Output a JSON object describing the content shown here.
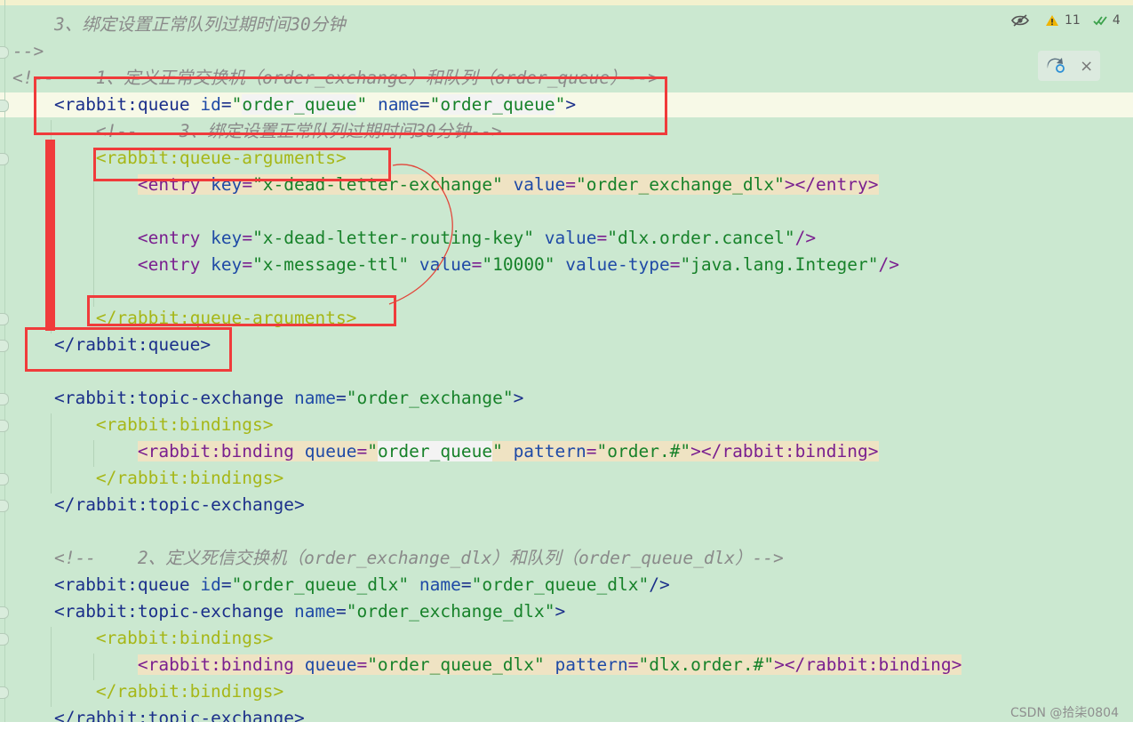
{
  "lines": [
    {
      "parts": [
        {
          "s": "c",
          "t": "    "
        }
      ]
    },
    {
      "parts": [
        {
          "s": "c",
          "t": "    3、绑定设置正常队列过期时间30分钟"
        }
      ]
    },
    {
      "parts": [
        {
          "s": "c",
          "t": "-->"
        }
      ]
    },
    {
      "parts": [
        {
          "s": "c",
          "t": "<!--    1、定义正常交换机（order_exchange）和队列（order_queue）-->"
        }
      ]
    },
    {
      "parts": [
        {
          "s": "p",
          "t": "    "
        },
        {
          "s": "t",
          "t": "<rabbit:queue "
        },
        {
          "s": "an",
          "t": "id"
        },
        {
          "s": "t",
          "t": "="
        },
        {
          "s": "v",
          "t": "\""
        },
        {
          "s": "v hb",
          "t": "order_queue"
        },
        {
          "s": "v",
          "t": "\" "
        },
        {
          "s": "an",
          "t": "name"
        },
        {
          "s": "t",
          "t": "="
        },
        {
          "s": "v",
          "t": "\""
        },
        {
          "s": "v hb",
          "t": "order_queue"
        },
        {
          "s": "v",
          "t": "\""
        },
        {
          "s": "t",
          "t": ">"
        }
      ]
    },
    {
      "parts": [
        {
          "s": "c",
          "t": "        <!--    3、绑定设置正常队列过期时间30分钟-->"
        }
      ]
    },
    {
      "parts": [
        {
          "s": "p",
          "t": "        "
        },
        {
          "s": "y",
          "t": "<rabbit:queue-arguments>"
        }
      ]
    },
    {
      "parts": [
        {
          "s": "p",
          "t": "            "
        },
        {
          "s": "tp hl",
          "t": "<entry "
        },
        {
          "s": "an hl",
          "t": "key"
        },
        {
          "s": "tp hl",
          "t": "="
        },
        {
          "s": "v hl",
          "t": "\"x-dead-letter-exchange\" "
        },
        {
          "s": "an hl",
          "t": "value"
        },
        {
          "s": "tp hl",
          "t": "="
        },
        {
          "s": "v hl",
          "t": "\"order_exchange_dlx\""
        },
        {
          "s": "tp hl",
          "t": "></entry>"
        }
      ]
    },
    {
      "parts": [
        {
          "s": "p",
          "t": " "
        }
      ]
    },
    {
      "parts": [
        {
          "s": "p",
          "t": "            "
        },
        {
          "s": "tp",
          "t": "<entry "
        },
        {
          "s": "an",
          "t": "key"
        },
        {
          "s": "tp",
          "t": "="
        },
        {
          "s": "v",
          "t": "\"x-dead-letter-routing-key\" "
        },
        {
          "s": "an",
          "t": "value"
        },
        {
          "s": "tp",
          "t": "="
        },
        {
          "s": "v",
          "t": "\"dlx.order.cancel\""
        },
        {
          "s": "tp",
          "t": "/>"
        }
      ]
    },
    {
      "parts": [
        {
          "s": "p",
          "t": "            "
        },
        {
          "s": "tp",
          "t": "<entry "
        },
        {
          "s": "an",
          "t": "key"
        },
        {
          "s": "tp",
          "t": "="
        },
        {
          "s": "v",
          "t": "\"x-message-ttl\" "
        },
        {
          "s": "an",
          "t": "value"
        },
        {
          "s": "tp",
          "t": "="
        },
        {
          "s": "v",
          "t": "\"10000\" "
        },
        {
          "s": "an",
          "t": "value-type"
        },
        {
          "s": "tp",
          "t": "="
        },
        {
          "s": "v",
          "t": "\"java.lang.Integer\""
        },
        {
          "s": "tp",
          "t": "/>"
        }
      ]
    },
    {
      "parts": [
        {
          "s": "p",
          "t": " "
        }
      ]
    },
    {
      "parts": [
        {
          "s": "p",
          "t": "        "
        },
        {
          "s": "y",
          "t": "</rabbit:queue-arguments>"
        }
      ]
    },
    {
      "parts": [
        {
          "s": "p",
          "t": "    "
        },
        {
          "s": "t",
          "t": "</rabbit:queue>"
        }
      ]
    },
    {
      "parts": [
        {
          "s": "p",
          "t": " "
        }
      ]
    },
    {
      "parts": [
        {
          "s": "p",
          "t": "    "
        },
        {
          "s": "t",
          "t": "<rabbit:topic-exchange "
        },
        {
          "s": "an",
          "t": "name"
        },
        {
          "s": "t",
          "t": "="
        },
        {
          "s": "v",
          "t": "\"order_exchange\""
        },
        {
          "s": "t",
          "t": ">"
        }
      ]
    },
    {
      "parts": [
        {
          "s": "p",
          "t": "        "
        },
        {
          "s": "y",
          "t": "<rabbit:bindings>"
        }
      ]
    },
    {
      "parts": [
        {
          "s": "p",
          "t": "            "
        },
        {
          "s": "tp hl",
          "t": "<rabbit:binding "
        },
        {
          "s": "an hl",
          "t": "queue"
        },
        {
          "s": "tp hl",
          "t": "="
        },
        {
          "s": "v hl",
          "t": "\""
        },
        {
          "s": "v hb",
          "t": "order_queue"
        },
        {
          "s": "v hl",
          "t": "\" "
        },
        {
          "s": "an hl",
          "t": "pattern"
        },
        {
          "s": "tp hl",
          "t": "="
        },
        {
          "s": "v hl",
          "t": "\"order.#\""
        },
        {
          "s": "tp hl",
          "t": "></rabbit:binding>"
        }
      ]
    },
    {
      "parts": [
        {
          "s": "p",
          "t": "        "
        },
        {
          "s": "y",
          "t": "</rabbit:bindings>"
        }
      ]
    },
    {
      "parts": [
        {
          "s": "p",
          "t": "    "
        },
        {
          "s": "t",
          "t": "</rabbit:topic-exchange>"
        }
      ]
    },
    {
      "parts": [
        {
          "s": "p",
          "t": " "
        }
      ]
    },
    {
      "parts": [
        {
          "s": "c",
          "t": "    <!--    2、定义死信交换机（order_exchange_dlx）和队列（order_queue_dlx）-->"
        }
      ]
    },
    {
      "parts": [
        {
          "s": "p",
          "t": "    "
        },
        {
          "s": "t",
          "t": "<rabbit:queue "
        },
        {
          "s": "an",
          "t": "id"
        },
        {
          "s": "t",
          "t": "="
        },
        {
          "s": "v",
          "t": "\"order_queue_dlx\" "
        },
        {
          "s": "an",
          "t": "name"
        },
        {
          "s": "t",
          "t": "="
        },
        {
          "s": "v",
          "t": "\"order_queue_dlx\""
        },
        {
          "s": "t",
          "t": "/>"
        }
      ]
    },
    {
      "parts": [
        {
          "s": "p",
          "t": "    "
        },
        {
          "s": "t",
          "t": "<rabbit:topic-exchange "
        },
        {
          "s": "an",
          "t": "name"
        },
        {
          "s": "t",
          "t": "="
        },
        {
          "s": "v",
          "t": "\"order_exchange_dlx\""
        },
        {
          "s": "t",
          "t": ">"
        }
      ]
    },
    {
      "parts": [
        {
          "s": "p",
          "t": "        "
        },
        {
          "s": "y",
          "t": "<rabbit:bindings>"
        }
      ]
    },
    {
      "parts": [
        {
          "s": "p",
          "t": "            "
        },
        {
          "s": "tp hl",
          "t": "<rabbit:binding "
        },
        {
          "s": "an hl",
          "t": "queue"
        },
        {
          "s": "tp hl",
          "t": "="
        },
        {
          "s": "v hl",
          "t": "\"order_queue_dlx\" "
        },
        {
          "s": "an hl",
          "t": "pattern"
        },
        {
          "s": "tp hl",
          "t": "="
        },
        {
          "s": "v hl",
          "t": "\"dlx.order.#\""
        },
        {
          "s": "tp hl",
          "t": "></rabbit:binding>"
        }
      ]
    },
    {
      "parts": [
        {
          "s": "p",
          "t": "        "
        },
        {
          "s": "y",
          "t": "</rabbit:bindings>"
        }
      ]
    },
    {
      "parts": [
        {
          "s": "p",
          "t": "    "
        },
        {
          "s": "t",
          "t": "</rabbit:topic-exchange>"
        }
      ]
    }
  ],
  "toolbar": {
    "warnings_count": "11",
    "checks_count": "4",
    "eye_icon": "eye-crossed-icon",
    "warning_icon": "warning-triangle-icon",
    "check_icon": "double-check-icon"
  },
  "popup": {
    "reload_icon": "maven-reload-icon",
    "close_icon": "close-icon",
    "close_label": "×"
  },
  "watermark": "CSDN @拾柒0804",
  "colors": {
    "background": "#cbe8d0",
    "annotation_red": "#f03b3b",
    "tag_blue": "#1b2f8a",
    "tag_olive": "#a6b718",
    "value_green": "#17822a",
    "comment_gray": "#8a8a8a"
  }
}
